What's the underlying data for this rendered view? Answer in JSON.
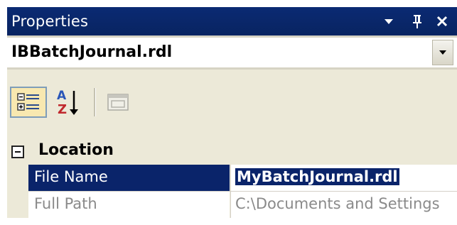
{
  "window": {
    "title": "Properties"
  },
  "object_selector": {
    "selected": "IBBatchJournal.rdl"
  },
  "toolbar": {
    "buttons": [
      {
        "icon": "categorized-icon",
        "pressed": true
      },
      {
        "icon": "alphabetical-sort-icon",
        "pressed": false
      },
      {
        "icon": "property-pages-icon",
        "pressed": false,
        "enabled": false
      }
    ]
  },
  "grid": {
    "category": {
      "label": "Location",
      "expanded": true
    },
    "rows": [
      {
        "name": "File Name",
        "value": "MyBatchJournal.rdl",
        "selected": true,
        "editable": true
      },
      {
        "name": "Full Path",
        "value": "C:\\Documents and Settings",
        "selected": false,
        "editable": false
      }
    ]
  },
  "colors": {
    "title_bg": "#0a246a",
    "selection": "#0a246a",
    "panel_bg": "#ece9d8",
    "disabled_text": "#8a8a8a"
  }
}
